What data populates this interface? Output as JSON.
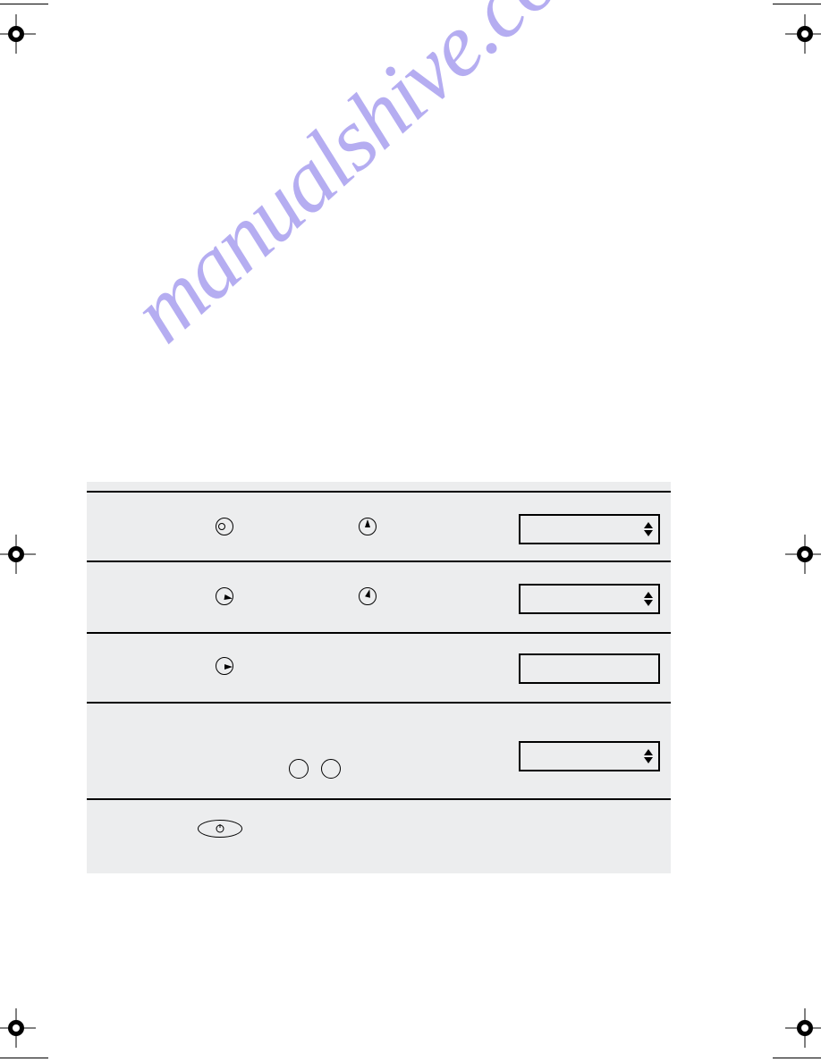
{
  "watermark": "manualshive.com",
  "rows": {
    "r1": {
      "knob1": "off-knob",
      "knob2": "pointer-12-knob",
      "display_has_arrows": true
    },
    "r2": {
      "knob1": "pointer-3-knob",
      "knob2": "pointer-1-knob",
      "display_has_arrows": true
    },
    "r3": {
      "knob1": "pointer-3-knob",
      "display_has_arrows": false
    },
    "r4": {
      "circles": 2,
      "display_has_arrows": true
    },
    "r5": {
      "button": "start-button"
    }
  }
}
